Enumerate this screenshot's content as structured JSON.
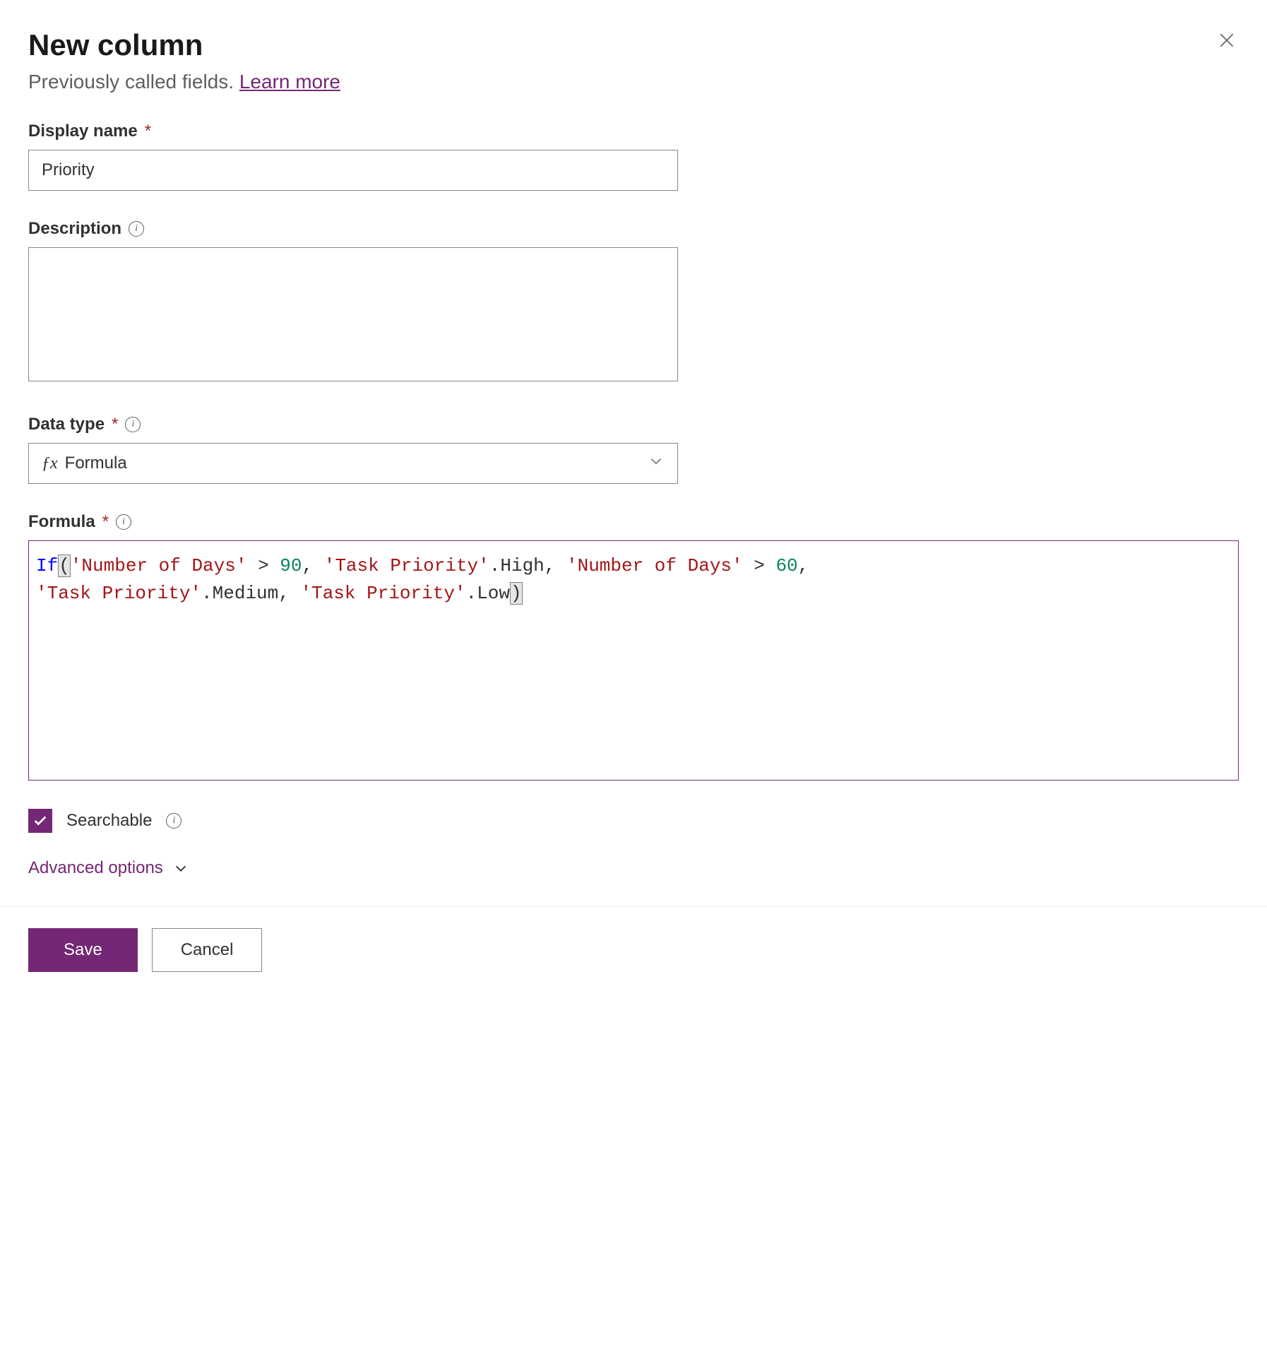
{
  "header": {
    "title": "New column",
    "subtitle_prefix": "Previously called fields. ",
    "learn_more": "Learn more"
  },
  "fields": {
    "display_name": {
      "label": "Display name",
      "value": "Priority"
    },
    "description": {
      "label": "Description",
      "value": ""
    },
    "data_type": {
      "label": "Data type",
      "value": "Formula"
    },
    "formula": {
      "label": "Formula",
      "tokens": [
        {
          "t": "If",
          "c": "tok-keyword"
        },
        {
          "t": "(",
          "c": "tok-paren-highlight"
        },
        {
          "t": "'Number of Days'",
          "c": "tok-string"
        },
        {
          "t": " > ",
          "c": "tok-punct"
        },
        {
          "t": "90",
          "c": "tok-number"
        },
        {
          "t": ", ",
          "c": "tok-punct"
        },
        {
          "t": "'Task Priority'",
          "c": "tok-string"
        },
        {
          "t": ".High, ",
          "c": "tok-punct"
        },
        {
          "t": "'Number of Days'",
          "c": "tok-string"
        },
        {
          "t": " > ",
          "c": "tok-punct"
        },
        {
          "t": "60",
          "c": "tok-number"
        },
        {
          "t": ", ",
          "c": "tok-punct"
        },
        {
          "t": "\n",
          "c": "break"
        },
        {
          "t": "'Task Priority'",
          "c": "tok-string"
        },
        {
          "t": ".Medium, ",
          "c": "tok-punct"
        },
        {
          "t": "'Task Priority'",
          "c": "tok-string"
        },
        {
          "t": ".Low",
          "c": "tok-punct"
        },
        {
          "t": ")",
          "c": "tok-paren-highlight"
        }
      ]
    }
  },
  "searchable": {
    "label": "Searchable",
    "checked": true
  },
  "advanced_options": "Advanced options",
  "buttons": {
    "save": "Save",
    "cancel": "Cancel"
  }
}
